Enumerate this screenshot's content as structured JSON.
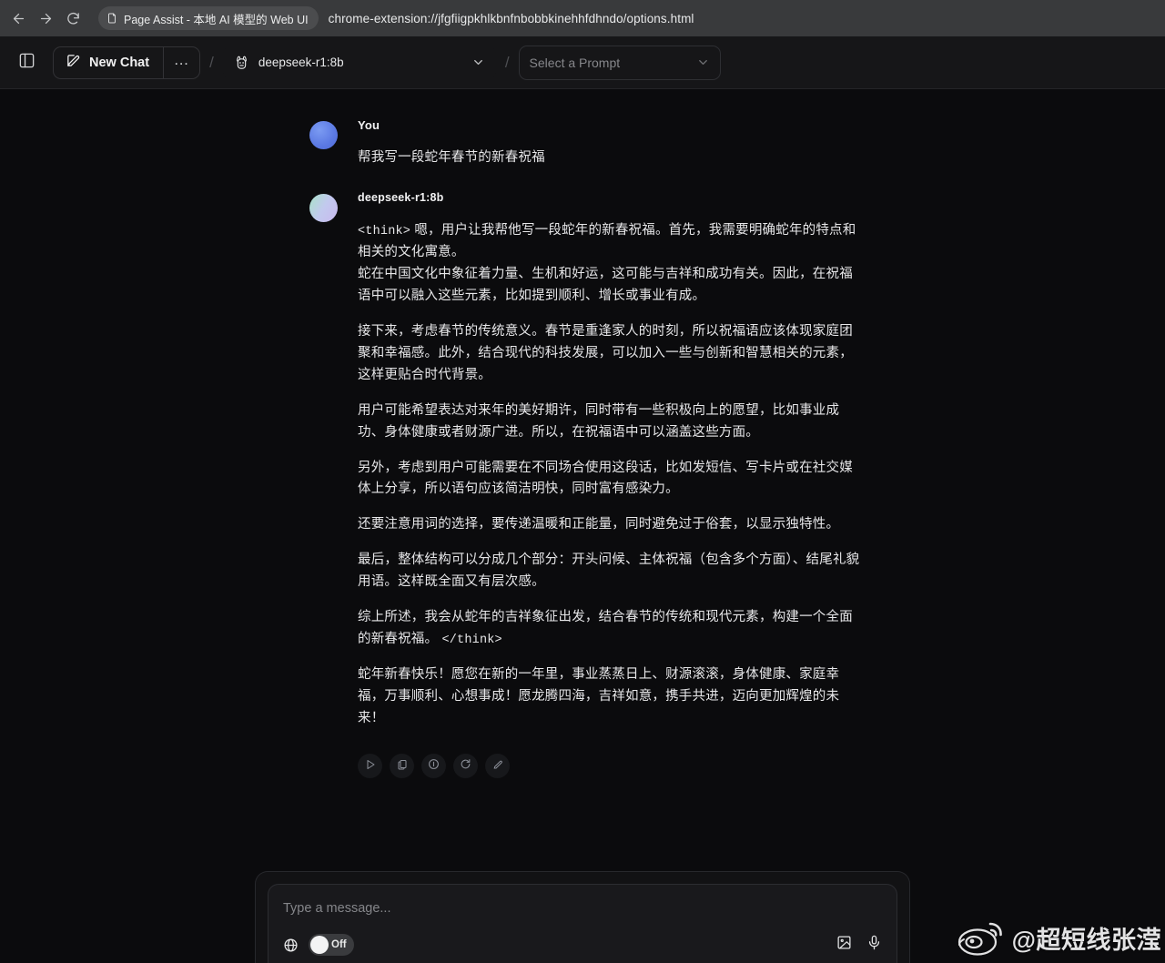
{
  "browser": {
    "back_icon": "back-arrow-icon",
    "forward_icon": "forward-arrow-icon",
    "reload_icon": "reload-icon",
    "page_title": "Page Assist - 本地 AI 模型的 Web UI",
    "url": "chrome-extension://jfgfiigpkhlkbnfnbobbkinehhfdhndo/options.html"
  },
  "header": {
    "panel_toggle_icon": "sidebar-panel-icon",
    "new_chat_label": "New Chat",
    "new_chat_icon": "pencil-square-icon",
    "more_label": "…",
    "separator": "/",
    "model": {
      "icon": "ollama-llama-icon",
      "value": "deepseek-r1:8b",
      "chevron": "chevron-down-icon"
    },
    "prompt": {
      "placeholder": "Select a Prompt",
      "chevron": "chevron-down-icon"
    }
  },
  "conversation": {
    "messages": [
      {
        "role": "user",
        "name": "You",
        "avatar": "user-avatar",
        "text": "帮我写一段蛇年春节的新春祝福"
      },
      {
        "role": "assistant",
        "name": "deepseek-r1:8b",
        "avatar": "assistant-avatar",
        "think_open": "<think>",
        "think_close": "</think>",
        "paragraphs": [
          "嗯，用户让我帮他写一段蛇年的新春祝福。首先，我需要明确蛇年的特点和相关的文化寓意。",
          "蛇在中国文化中象征着力量、生机和好运，这可能与吉祥和成功有关。因此，在祝福语中可以融入这些元素，比如提到顺利、增长或事业有成。",
          "接下来，考虑春节的传统意义。春节是重逢家人的时刻，所以祝福语应该体现家庭团聚和幸福感。此外，结合现代的科技发展，可以加入一些与创新和智慧相关的元素，这样更贴合时代背景。",
          "用户可能希望表达对来年的美好期许，同时带有一些积极向上的愿望，比如事业成功、身体健康或者财源广进。所以，在祝福语中可以涵盖这些方面。",
          "另外，考虑到用户可能需要在不同场合使用这段话，比如发短信、写卡片或在社交媒体上分享，所以语句应该简洁明快，同时富有感染力。",
          "还要注意用词的选择，要传递温暖和正能量，同时避免过于俗套，以显示独特性。",
          "最后，整体结构可以分成几个部分：开头问候、主体祝福（包含多个方面）、结尾礼貌用语。这样既全面又有层次感。",
          "综上所述，我会从蛇年的吉祥象征出发，结合春节的传统和现代元素，构建一个全面的新春祝福。"
        ],
        "answer": "蛇年新春快乐！愿您在新的一年里，事业蒸蒸日上、财源滚滚，身体健康、家庭幸福，万事顺利、心想事成！愿龙腾四海，吉祥如意，携手共进，迈向更加辉煌的未来！",
        "actions": [
          {
            "name": "play-audio-button",
            "icon": "play-icon"
          },
          {
            "name": "copy-button",
            "icon": "copy-icon"
          },
          {
            "name": "info-button",
            "icon": "info-icon"
          },
          {
            "name": "regenerate-button",
            "icon": "regenerate-icon"
          },
          {
            "name": "edit-button",
            "icon": "pencil-icon"
          }
        ]
      }
    ]
  },
  "composer": {
    "placeholder": "Type a message...",
    "web_search": {
      "icon": "globe-icon",
      "state_label": "Off"
    },
    "image_icon": "image-upload-icon",
    "mic_icon": "microphone-icon"
  },
  "watermark": {
    "logo": "weibo-logo-icon",
    "handle": "@超短线张滢"
  },
  "colors": {
    "page_bg": "#0b0b0d",
    "header_bg": "#161618",
    "browser_bg": "#393a3c",
    "text": "#e7e7e9",
    "muted": "#85868a",
    "user_avatar": "#5b79e3",
    "assistant_avatar_start": "#a8e3c8",
    "assistant_avatar_end": "#c9b9ee"
  }
}
